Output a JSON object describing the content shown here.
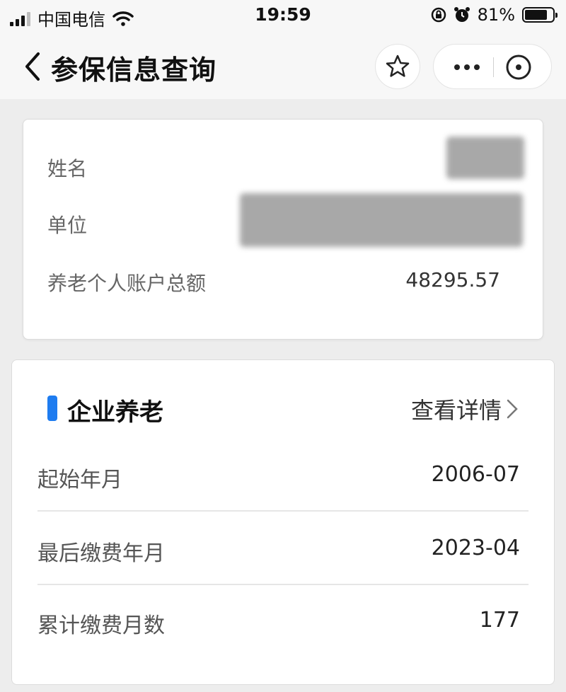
{
  "status_bar": {
    "carrier": "中国电信",
    "time": "19:59",
    "battery": "81%",
    "battery_level": 0.81
  },
  "nav": {
    "title": "参保信息查询",
    "icons": [
      "chevron-left-icon",
      "star-icon",
      "more-icon",
      "close-circle-icon"
    ]
  },
  "personal": {
    "name_label": "姓名",
    "unit_label": "单位",
    "account_label": "养老个人账户总额",
    "account_value": "48295.57"
  },
  "pension": {
    "section_title": "企业养老",
    "detail_link": "查看详情",
    "rows": [
      {
        "label": "起始年月",
        "value": "2006-07"
      },
      {
        "label": "最后缴费年月",
        "value": "2023-04"
      },
      {
        "label": "累计缴费月数",
        "value": "177"
      }
    ]
  },
  "colors": {
    "accent": "#1e7cf0",
    "background": "#ededed",
    "card": "#ffffff"
  }
}
